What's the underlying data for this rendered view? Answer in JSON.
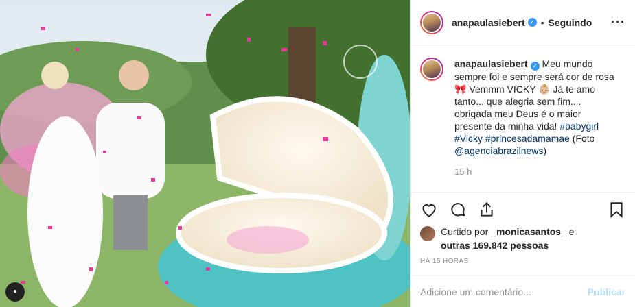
{
  "post": {
    "username": "anapaulasiebert",
    "follow_status": "Seguindo",
    "more_icon": "ellipsis-icon",
    "caption_user": "anapaulasiebert",
    "caption_text_1": "Meu mundo sempre foi e sempre será cor de rosa 🎀 Vemmm VICKY 👶🏼 Já te amo tanto... que alegria sem fim.... obrigada meu Deus é o maior presente da minha vida! ",
    "hashtag_1": "#babygirl",
    "hashtag_2": "#Vicky",
    "hashtag_3": "#princesadamamae",
    "caption_text_2": " (Foto ",
    "mention": "@agenciabrazilnews",
    "caption_text_3": ")",
    "timestamp": "15 h",
    "liked_by_prefix": "Curtido por ",
    "liked_by_user": "_monicasantos_",
    "liked_by_and": " e",
    "others": "outras 169.842 pessoas",
    "posted_ago": "HÁ 15 HORAS",
    "comment_placeholder": "Adicione um comentário...",
    "publish_label": "Publicar"
  },
  "colors": {
    "link": "#003569",
    "verified": "#3897f0",
    "publish_disabled": "#b2dffc",
    "muted": "#8e8e8e"
  }
}
